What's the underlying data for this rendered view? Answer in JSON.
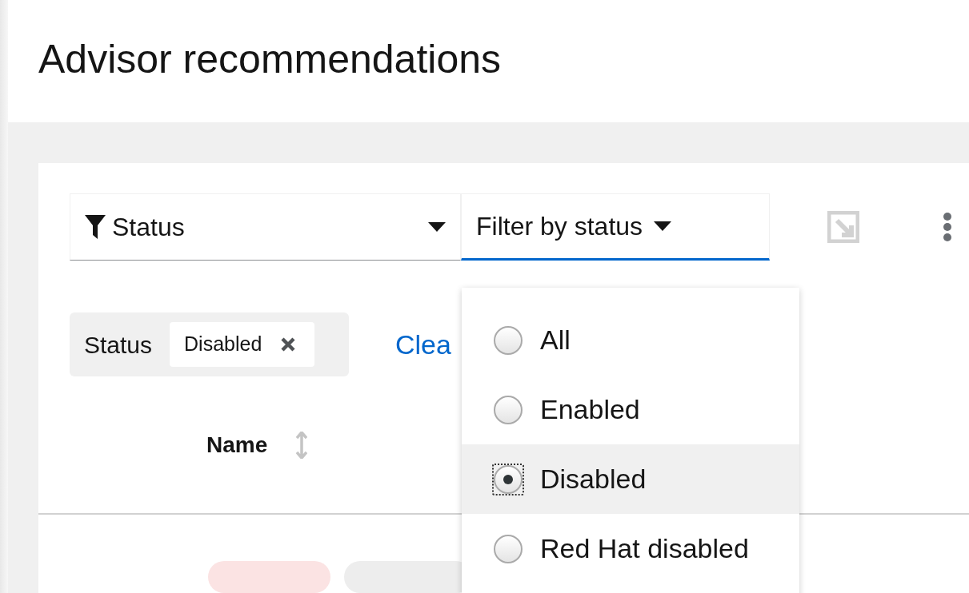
{
  "page_title": "Advisor recommendations",
  "toolbar": {
    "attribute_select": {
      "label": "Status",
      "expanded": false
    },
    "value_select": {
      "placeholder": "Filter by status",
      "expanded": true
    }
  },
  "chip_group": {
    "category": "Status",
    "chips": [
      {
        "label": "Disabled"
      }
    ]
  },
  "clear_link": "Clea",
  "table": {
    "columns": [
      {
        "label": "Name",
        "sortable": true
      }
    ]
  },
  "status_menu": {
    "options": [
      {
        "label": "All",
        "selected": false
      },
      {
        "label": "Enabled",
        "selected": false
      },
      {
        "label": "Disabled",
        "selected": true
      },
      {
        "label": "Red Hat disabled",
        "selected": false
      }
    ]
  }
}
